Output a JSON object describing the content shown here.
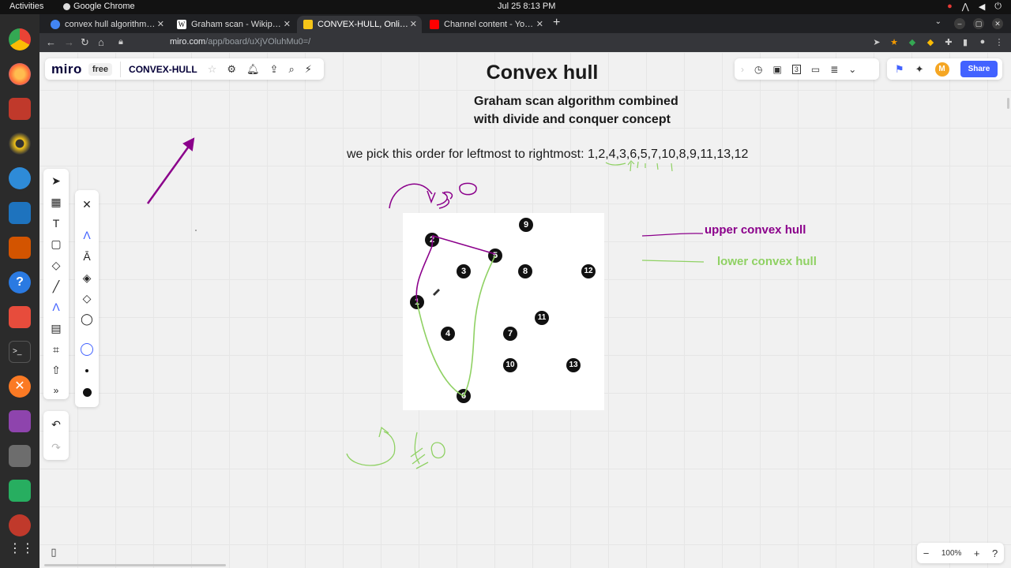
{
  "os": {
    "activities": "Activities",
    "app_name": "Google Chrome",
    "clock": "Jul 25  8:13 PM"
  },
  "browser": {
    "tabs": [
      {
        "title": "convex hull algorithm - Go",
        "favicon_color": "#4285f4"
      },
      {
        "title": "Graham scan - Wikipedia",
        "favicon_color": "#ffffff"
      },
      {
        "title": "CONVEX-HULL, Online Wh",
        "favicon_color": "#f5c518"
      },
      {
        "title": "Channel content - YouTub",
        "favicon_color": "#ff0000"
      }
    ],
    "url_host": "miro.com",
    "url_path": "/app/board/uXjVOluhMu0=/"
  },
  "miro": {
    "logo": "miro",
    "plan": "free",
    "board_name": "CONVEX-HULL",
    "share_label": "Share",
    "avatar_initial": "M",
    "zoom_level": "100%",
    "timer_count": "3"
  },
  "board": {
    "title": "Convex hull",
    "subtitle_line1": "Graham scan algorithm combined",
    "subtitle_line2": "with divide and conquer concept",
    "order_text": "we pick this order for leftmost to rightmost: 1,2,4,3,6,5,7,10,8,9,11,13,12",
    "legend_upper": "upper convex hull",
    "legend_lower": "lower convex hull",
    "upper_color": "#8b008b",
    "lower_color": "#8fd163",
    "points": [
      {
        "label": "1"
      },
      {
        "label": "2"
      },
      {
        "label": "3"
      },
      {
        "label": "4"
      },
      {
        "label": "5"
      },
      {
        "label": "6"
      },
      {
        "label": "7"
      },
      {
        "label": "8"
      },
      {
        "label": "9"
      },
      {
        "label": "10"
      },
      {
        "label": "11"
      },
      {
        "label": "12"
      },
      {
        "label": "13"
      }
    ]
  }
}
